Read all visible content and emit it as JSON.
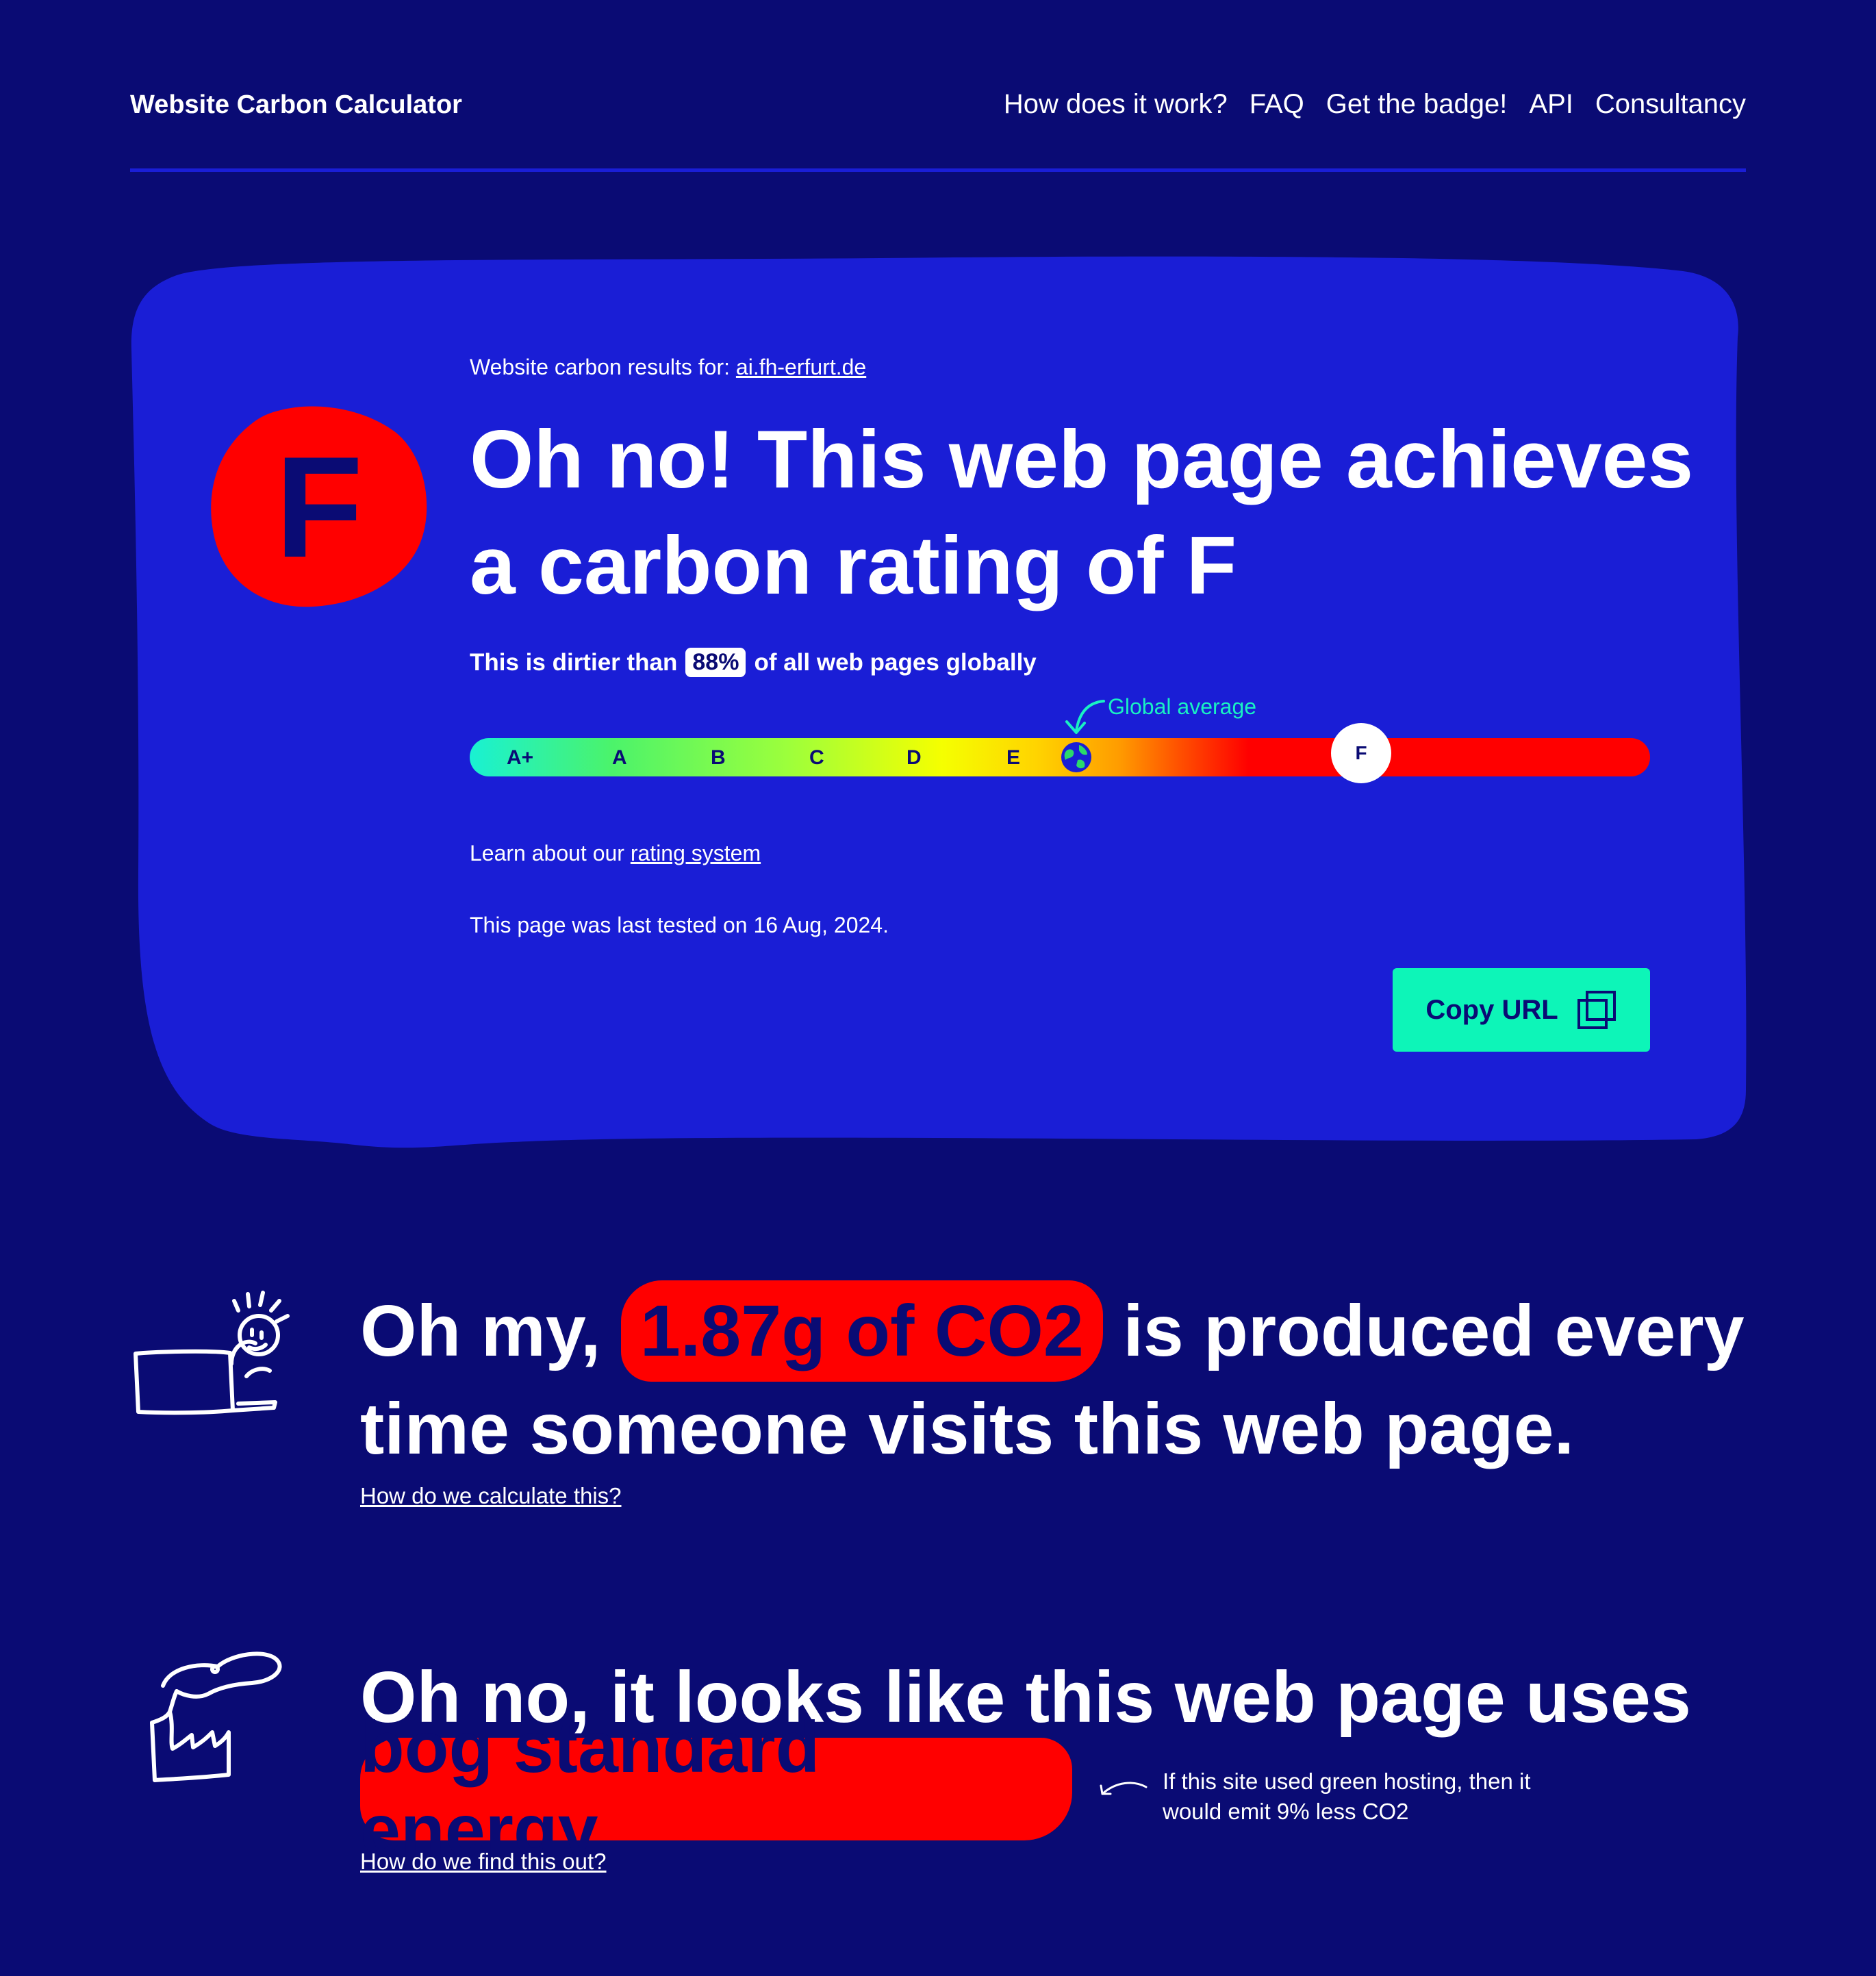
{
  "header": {
    "brand": "Website Carbon Calculator",
    "nav": [
      "How does it work?",
      "FAQ",
      "Get the badge!",
      "API",
      "Consultancy"
    ]
  },
  "result": {
    "label_prefix": "Website carbon results for:",
    "domain": "ai.fh-erfurt.de",
    "grade": "F",
    "headline": "Oh no! This web page achieves a carbon rating of F",
    "dirtier_prefix": "This is dirtier than",
    "dirtier_percent": "88%",
    "dirtier_suffix": "of all web pages globally",
    "scale_labels": [
      "A+",
      "A",
      "B",
      "C",
      "D",
      "E"
    ],
    "marker_label": "F",
    "global_average_label": "Global average",
    "learn_prefix": "Learn about our",
    "learn_link": "rating system",
    "tested": "This page was last tested on 16 Aug, 2024.",
    "copy_button": "Copy URL"
  },
  "co2": {
    "prefix": "Oh my,",
    "amount": "1.87g of CO2",
    "suffix": "is produced every time someone visits this web page.",
    "link": "How do we calculate this?"
  },
  "energy": {
    "line1": "Oh no, it looks like this web page uses",
    "highlight": "bog standard energy",
    "note": "If this site used green hosting, then it would emit 9% less CO2",
    "link": "How do we find this out?"
  },
  "colors": {
    "background": "#0a0b74",
    "card": "#1a1ed6",
    "accent": "#0df5b8",
    "highlight_red": "#ff0000"
  },
  "icons": [
    "copy-icon",
    "globe-icon",
    "laptop-person-illustration",
    "factory-illustration",
    "curved-arrow-icon"
  ]
}
